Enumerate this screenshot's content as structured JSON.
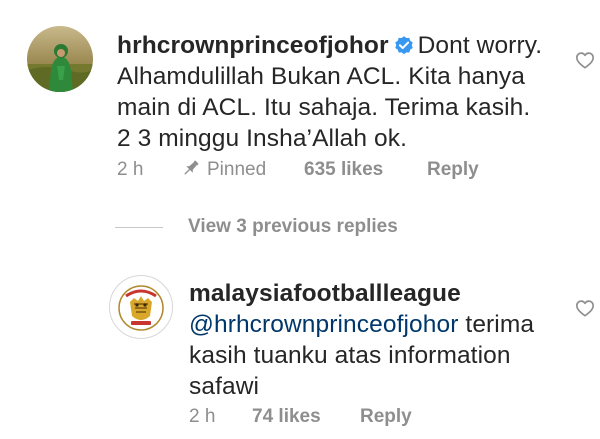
{
  "colors": {
    "text": "#262626",
    "muted": "#8e8e8e",
    "mention": "#00376b",
    "verified_badge": "#3897f0"
  },
  "comments": [
    {
      "username": "hrhcrownprinceofjohor",
      "verified": true,
      "text": "Dont worry. Alhamdulillah Bukan ACL. Kita hanya main di ACL. Itu sahaja. Terima kasih. 2 3 minggu Insha’Allah ok.",
      "time": "2 h",
      "pinned_label": "Pinned",
      "likes": "635 likes",
      "reply_label": "Reply",
      "avatar_icon": "user-photo-avatar",
      "like_icon": "heart-outline-icon"
    }
  ],
  "view_replies": {
    "label": "View 3 previous replies"
  },
  "replies": [
    {
      "username": "malaysiafootballleague",
      "mention": "@hrhcrownprinceofjohor",
      "text": "terima kasih tuanku atas information safawi",
      "time": "2 h",
      "likes": "74 likes",
      "reply_label": "Reply",
      "avatar_icon": "malaysia-league-logo-avatar",
      "like_icon": "heart-outline-icon"
    }
  ]
}
